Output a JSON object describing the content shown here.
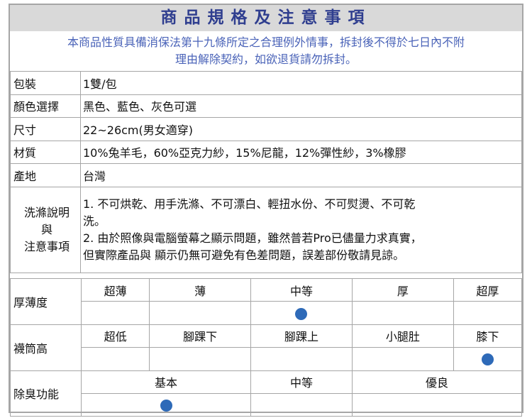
{
  "title": "商品規格及注意事項",
  "notice": {
    "line1": "本商品性質具備消保法第十九條所定之合理例外情事，拆封後不得於七日內不附",
    "line2": "理由解除契約，如欲退貨請勿拆封。"
  },
  "specs": [
    {
      "key": "包裝",
      "value": "1雙/包"
    },
    {
      "key": "顏色選擇",
      "value": "黑色、藍色、灰色可選"
    },
    {
      "key": "尺寸",
      "value": "22~26cm(男女適穿)"
    },
    {
      "key": "材質",
      "value": "10%兔羊毛，60%亞克力紗，15%尼龍，12%彈性紗，3%橡膠"
    },
    {
      "key": "產地",
      "value": "台灣"
    }
  ],
  "care": {
    "key_line1": "洗滌說明",
    "key_line2": "與",
    "key_line3": "注意事項",
    "line1": "1.  不可烘乾、用手洗滌、不可漂白、輕扭水份、不可熨燙、不可乾",
    "line2": "洗。",
    "line3": "2.  由於照像與電腦螢幕之顯示問題，雖然普若Pro已儘量力求真實，",
    "line4": "但實際產品與  顯示仍無可避免有色差問題，誤差部份敬請見諒。"
  },
  "thickness": {
    "label": "厚薄度",
    "options": [
      "超薄",
      "薄",
      "中等",
      "厚",
      "超厚"
    ],
    "selected": "中等"
  },
  "sock_height": {
    "label": "襪筒高",
    "options": [
      "超低",
      "腳踝下",
      "腳踝上",
      "小腿肚",
      "膝下"
    ],
    "selected": "膝下"
  },
  "deodorant": {
    "label": "除臭功能",
    "options": [
      "基本",
      "中等",
      "優良"
    ],
    "selected": "基本"
  },
  "colors": {
    "title_text": "#2f3e8f",
    "notice_text": "#4a63b8",
    "marker": "#2e6ab8"
  }
}
